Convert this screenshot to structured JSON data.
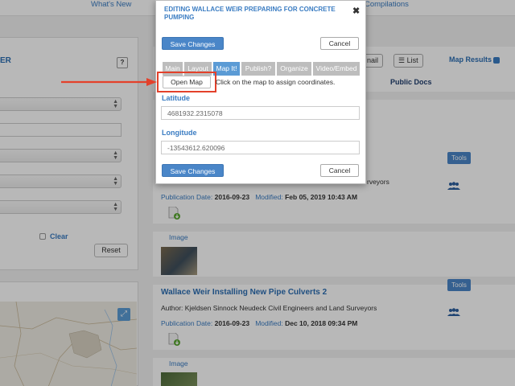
{
  "topnav": {
    "whats_new": "What's New",
    "compilations": "Compilations"
  },
  "left_panel": {
    "title_fragment": "ER",
    "help_label": "?",
    "clear_label": "Clear",
    "reset_label": "Reset"
  },
  "map_panel": {
    "expand_icon": "expand-icon"
  },
  "results_toolbar": {
    "email_fragment": "nail",
    "list_label": "List",
    "map_results_label": "Map Results",
    "public_docs_label": "Public Docs"
  },
  "documents": [
    {
      "author_fragment": "rveyors",
      "pub_label": "Publication Date:",
      "pub_date": "2016-09-23",
      "mod_label": "Modified:",
      "mod_date": "Feb 05, 2019 10:43 AM",
      "image_label": "Image",
      "tools_label": "Tools"
    },
    {
      "title": "Wallace Weir Installing New Pipe Culverts 2",
      "author": "Author: Kjeldsen Sinnock Neudeck Civil Engineers and Land Surveyors",
      "pub_label": "Publication Date:",
      "pub_date": "2016-09-23",
      "mod_label": "Modified:",
      "mod_date": "Dec 10, 2018 09:34 PM",
      "image_label": "Image",
      "tools_label": "Tools"
    }
  ],
  "modal": {
    "title": "Editing Wallace Weir Preparing for Concrete Pumping",
    "close_icon": "close-icon",
    "save_label": "Save Changes",
    "cancel_label": "Cancel",
    "tabs": [
      {
        "label": "Main",
        "active": false
      },
      {
        "label": "Layout",
        "active": false
      },
      {
        "label": "Map It!",
        "active": true
      },
      {
        "label": "Publish?",
        "active": false
      },
      {
        "label": "Organize",
        "active": false
      },
      {
        "label": "Video/Embed",
        "active": false
      }
    ],
    "open_map_label": "Open Map",
    "hint": "Click on the map to assign coordinates.",
    "latitude_label": "Latitude",
    "latitude_value": "4681932.2315078",
    "longitude_label": "Longitude",
    "longitude_value": "-13543612.620096"
  },
  "colors": {
    "accent": "#3a7cc2",
    "primary_button": "#4a86c8",
    "highlight": "#e3412b",
    "active_tab": "#5b9bd5",
    "inactive_tab": "#bdbdbd"
  }
}
